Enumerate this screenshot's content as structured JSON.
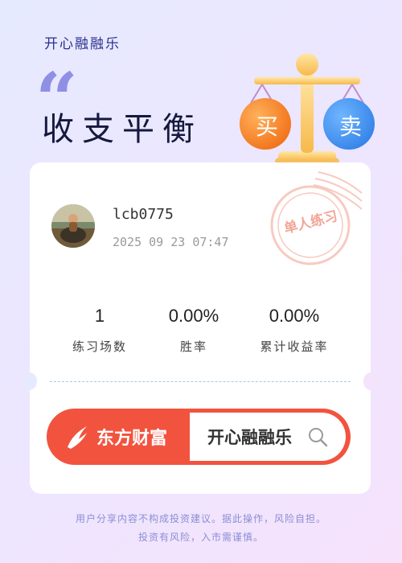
{
  "brand": {
    "top_label": "开心融融乐"
  },
  "header": {
    "headline": "收支平衡",
    "scale_left_badge": "买",
    "scale_right_badge": "卖"
  },
  "card": {
    "username": "lcb0775",
    "datetime": "2025 09 23 07:47",
    "stamp_text": "单人练习",
    "stats": [
      {
        "value": "1",
        "label": "练习场数"
      },
      {
        "value": "0.00%",
        "label": "胜率"
      },
      {
        "value": "0.00%",
        "label": "累计收益率"
      }
    ],
    "search": {
      "logo_text": "东方财富",
      "query": "开心融融乐"
    }
  },
  "footer": {
    "line1": "用户分享内容不构成投资建议。据此操作，风险自担。",
    "line2": "投资有风险，入市需谨慎。"
  },
  "colors": {
    "accent_red": "#f2533f",
    "buy_orange": "#f5791f",
    "sell_blue": "#3b8df0",
    "headline": "#15193d",
    "brand_blue": "#2b2f8f"
  }
}
